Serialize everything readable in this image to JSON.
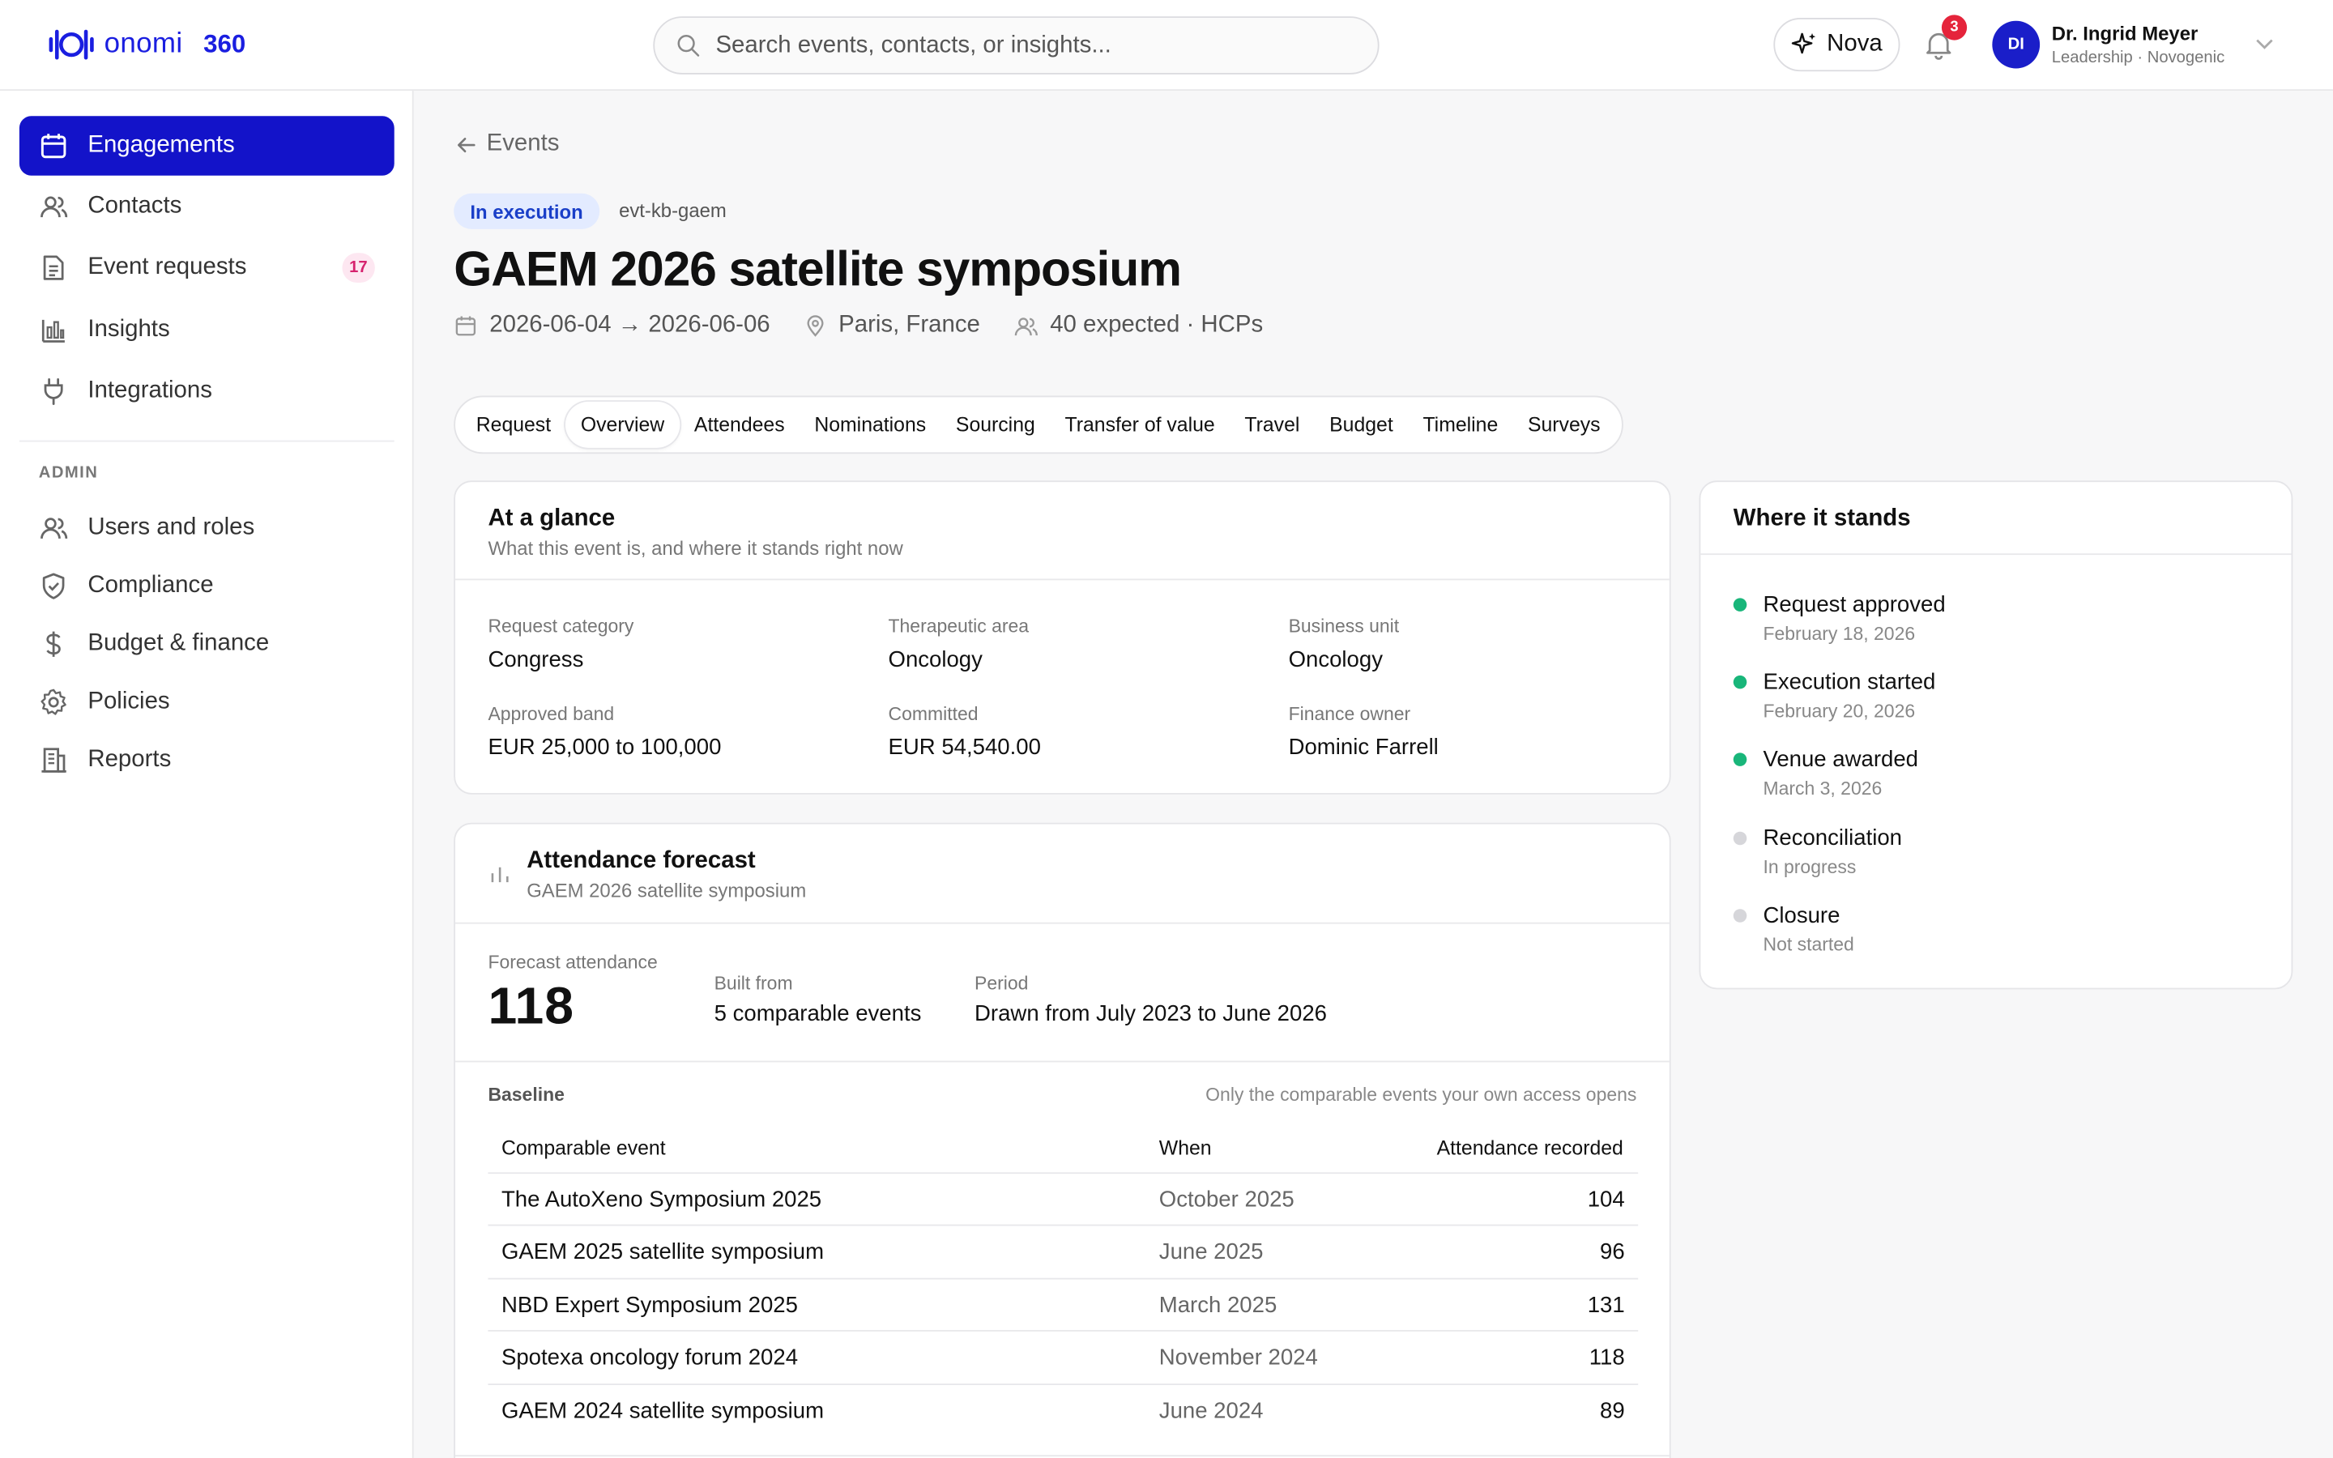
{
  "brand": {
    "name": "onomi",
    "product": "360",
    "color": "#1a1ee0"
  },
  "search": {
    "placeholder": "Search events, contacts, or insights..."
  },
  "header": {
    "assistant_label": "Nova",
    "notifications_count": "3",
    "user": {
      "initials": "DI",
      "name": "Dr. Ingrid Meyer",
      "subtitle": "Leadership · Novogenic"
    }
  },
  "sidebar": {
    "items": [
      {
        "label": "Engagements",
        "icon": "calendar-icon",
        "active": true
      },
      {
        "label": "Contacts",
        "icon": "users-icon"
      },
      {
        "label": "Event requests",
        "icon": "document-icon",
        "badge": "17"
      },
      {
        "label": "Insights",
        "icon": "bar-chart-icon"
      },
      {
        "label": "Integrations",
        "icon": "plug-icon"
      }
    ],
    "admin_heading": "ADMIN",
    "admin_items": [
      {
        "label": "Users and roles",
        "icon": "users-icon"
      },
      {
        "label": "Compliance",
        "icon": "shield-icon"
      },
      {
        "label": "Budget & finance",
        "icon": "dollar-icon"
      },
      {
        "label": "Policies",
        "icon": "gear-icon"
      },
      {
        "label": "Reports",
        "icon": "building-icon"
      }
    ]
  },
  "event": {
    "back_label": "Events",
    "status": "In execution",
    "id": "evt-kb-gaem",
    "title": "GAEM 2026 satellite symposium",
    "dates": "2026-06-04 → 2026-06-06",
    "location": "Paris, France",
    "audience": "40 expected · HCPs"
  },
  "tabs": [
    "Request",
    "Overview",
    "Attendees",
    "Nominations",
    "Sourcing",
    "Transfer of value",
    "Travel",
    "Budget",
    "Timeline",
    "Surveys"
  ],
  "active_tab": "Overview",
  "glance": {
    "title": "At a glance",
    "subtitle": "What this event is, and where it stands right now",
    "fields": [
      {
        "label": "Request category",
        "value": "Congress"
      },
      {
        "label": "Therapeutic area",
        "value": "Oncology"
      },
      {
        "label": "Business unit",
        "value": "Oncology"
      },
      {
        "label": "Approved band",
        "value": "EUR 25,000 to 100,000"
      },
      {
        "label": "Committed",
        "value": "EUR 54,540.00"
      },
      {
        "label": "Finance owner",
        "value": "Dominic Farrell"
      }
    ]
  },
  "forecast": {
    "title": "Attendance forecast",
    "subtitle": "GAEM 2026 satellite symposium",
    "forecast_label": "Forecast attendance",
    "forecast_value": "118",
    "built_from_label": "Built from",
    "built_from_value": "5 comparable events",
    "period_label": "Period",
    "period_value": "Drawn from July 2023 to June 2026",
    "baseline_label": "Baseline",
    "baseline_note": "Only the comparable events your own access opens",
    "columns": [
      "Comparable event",
      "When",
      "Attendance recorded"
    ],
    "rows": [
      {
        "event": "The AutoXeno Symposium 2025",
        "when": "October 2025",
        "attendance": "104"
      },
      {
        "event": "GAEM 2025 satellite symposium",
        "when": "June 2025",
        "attendance": "96"
      },
      {
        "event": "NBD Expert Symposium 2025",
        "when": "March 2025",
        "attendance": "131"
      },
      {
        "event": "Spotexa oncology forum 2024",
        "when": "November 2024",
        "attendance": "118"
      },
      {
        "event": "GAEM 2024 satellite symposium",
        "when": "June 2024",
        "attendance": "89"
      }
    ]
  },
  "status_panel": {
    "title": "Where it stands",
    "steps": [
      {
        "title": "Request approved",
        "detail": "February 18, 2026",
        "state": "done"
      },
      {
        "title": "Execution started",
        "detail": "February 20, 2026",
        "state": "done"
      },
      {
        "title": "Venue awarded",
        "detail": "March 3, 2026",
        "state": "done"
      },
      {
        "title": "Reconciliation",
        "detail": "In progress",
        "state": "pending"
      },
      {
        "title": "Closure",
        "detail": "Not started",
        "state": "pending"
      }
    ],
    "colors": {
      "done": "#19b67a",
      "pending": "#d6d6da"
    }
  }
}
